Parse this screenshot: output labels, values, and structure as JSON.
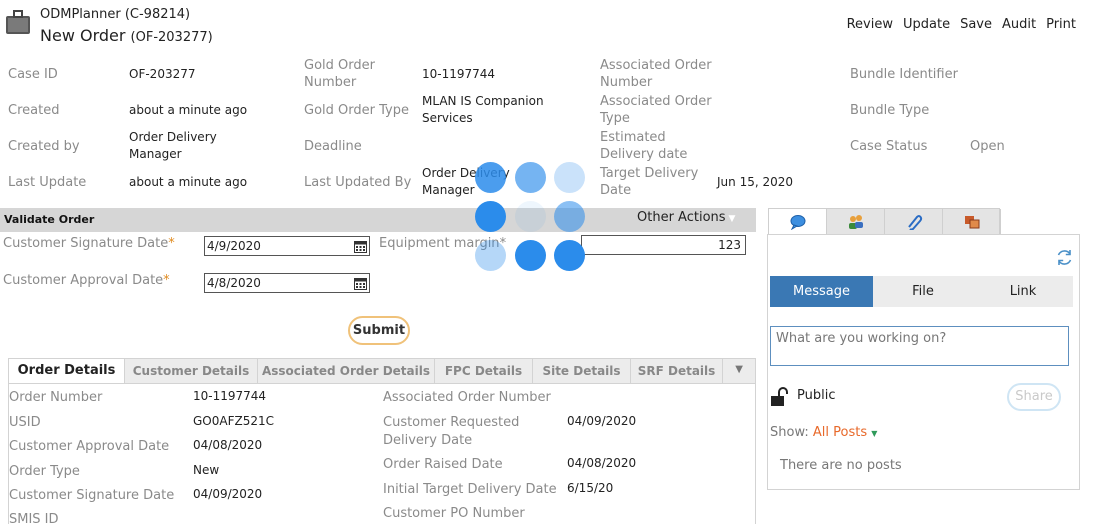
{
  "header": {
    "app_name": "ODMPlanner (C-98214)",
    "order_title": "New Order",
    "order_id": "(OF-203277)",
    "actions": [
      "Review",
      "Update",
      "Save",
      "Audit",
      "Print"
    ]
  },
  "info": {
    "col1": [
      {
        "label": "Case ID",
        "value": "OF-203277"
      },
      {
        "label": "Created",
        "value": "about a minute ago"
      },
      {
        "label": "Created by",
        "value": "Order Delivery Manager"
      },
      {
        "label": "Last Update",
        "value": "about a minute ago"
      }
    ],
    "col2": [
      {
        "label": "Gold Order Number",
        "value": "10-1197744"
      },
      {
        "label": "Gold Order Type",
        "value": "MLAN IS Companion Services"
      },
      {
        "label": "Deadline",
        "value": ""
      },
      {
        "label": "Last Updated By",
        "value": "Order Delivery Manager"
      }
    ],
    "col3": [
      {
        "label": "Associated Order Number",
        "value": ""
      },
      {
        "label": "Associated Order Type",
        "value": ""
      },
      {
        "label": "Estimated Delivery date",
        "value": ""
      },
      {
        "label": "Target Delivery Date",
        "value": "Jun 15, 2020"
      }
    ],
    "col4": [
      {
        "label": "Bundle Identifier",
        "value": ""
      },
      {
        "label": "Bundle Type",
        "value": ""
      },
      {
        "label": "Case Status",
        "value": "Open"
      }
    ]
  },
  "validate": {
    "title": "Validate Order",
    "other_actions": "Other Actions",
    "customer_signature_label": "Customer Signature Date",
    "customer_signature_value": "4/9/2020",
    "customer_approval_label": "Customer Approval Date",
    "customer_approval_value": "4/8/2020",
    "equipment_margin_label": "Equipment margin",
    "equipment_margin_value": "123",
    "required_mark": "*",
    "submit": "Submit"
  },
  "order_tabs": [
    "Order Details",
    "Customer Details",
    "Associated Order Details",
    "FPC Details",
    "Site Details",
    "SRF Details"
  ],
  "order_details": {
    "left": [
      {
        "label": "Order Number",
        "value": "10-1197744"
      },
      {
        "label": "USID",
        "value": "GO0AFZ521C"
      },
      {
        "label": "Customer Approval Date",
        "value": "04/08/2020"
      },
      {
        "label": "Order Type",
        "value": "New"
      },
      {
        "label": "Customer Signature Date",
        "value": "04/09/2020"
      },
      {
        "label": "SMIS ID",
        "value": ""
      }
    ],
    "right": [
      {
        "label": "Associated Order Number",
        "value": ""
      },
      {
        "label": "Customer Requested Delivery Date",
        "value": "04/09/2020"
      },
      {
        "label": "Order Raised Date",
        "value": "04/08/2020"
      },
      {
        "label": "Initial Target Delivery Date",
        "value": "6/15/20"
      },
      {
        "label": "Customer PO Number",
        "value": ""
      }
    ]
  },
  "pulse": {
    "tab_icons": [
      "speech-bubble-icon",
      "people-icon",
      "paperclip-icon",
      "documents-icon"
    ],
    "segments": [
      "Message",
      "File",
      "Link"
    ],
    "placeholder": "What are you working on?",
    "visibility": "Public",
    "share": "Share",
    "show_label": "Show:",
    "show_value": "All Posts",
    "empty": "There are no posts"
  },
  "colors": {
    "accent_blue": "#3a78b4",
    "required_orange": "#e08a1e",
    "spinner_blue": "#2b8ceb"
  }
}
